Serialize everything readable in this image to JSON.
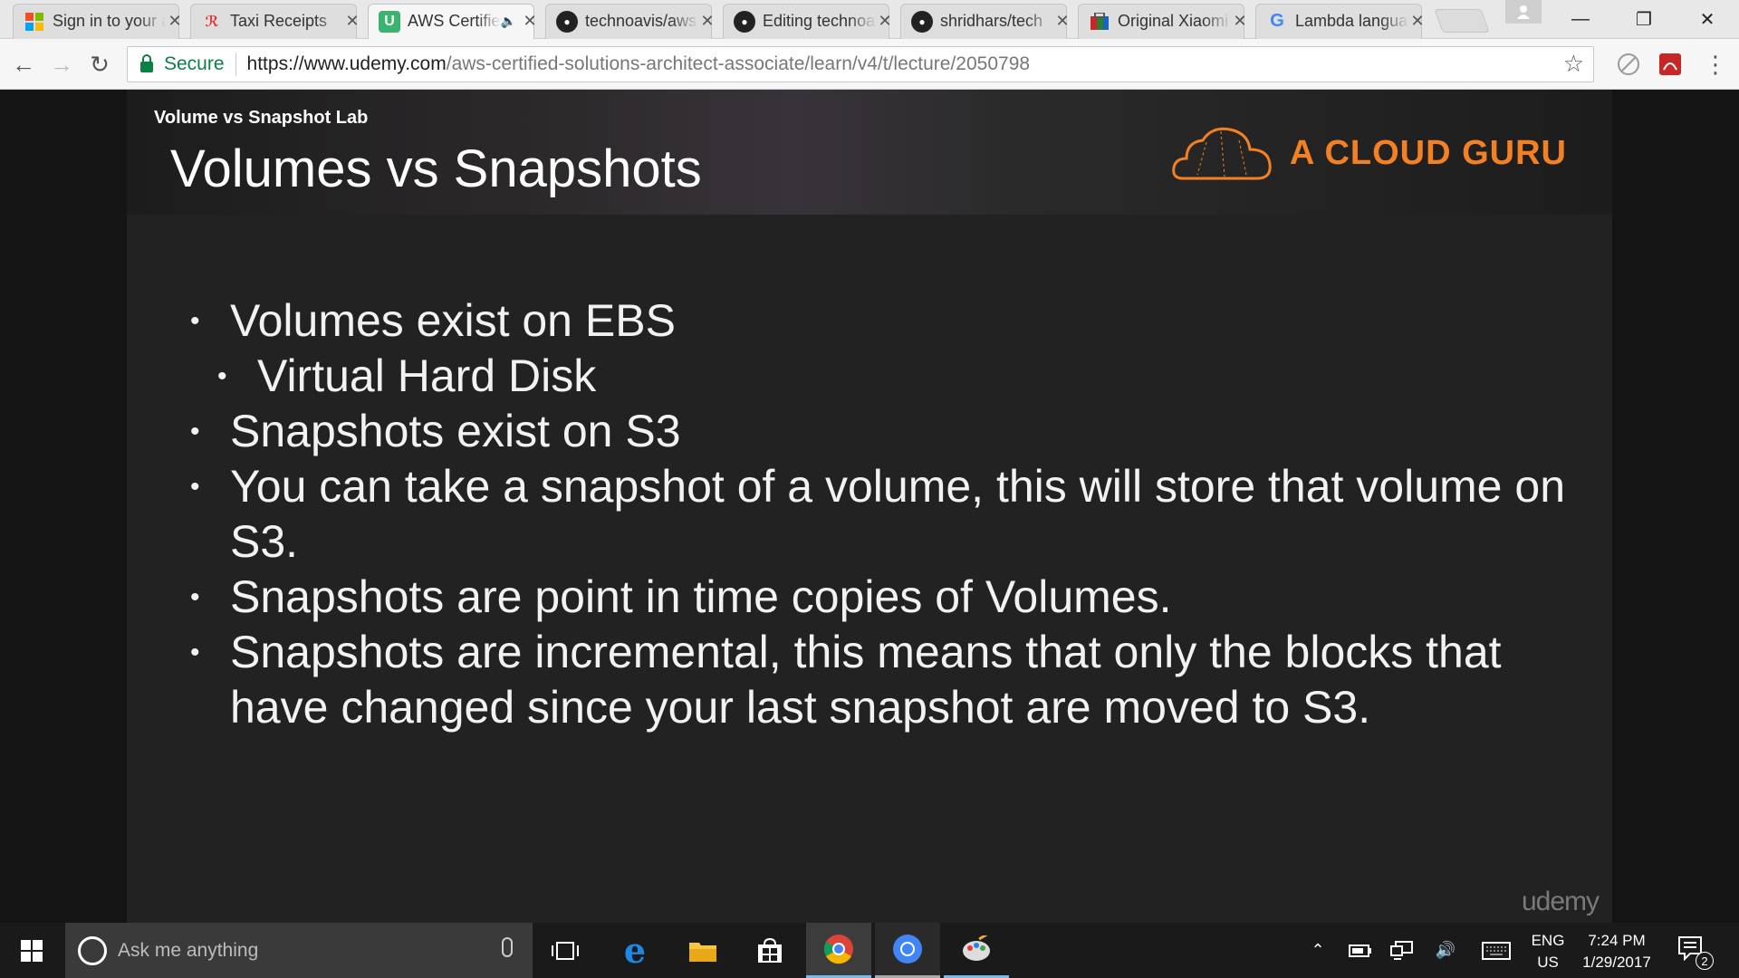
{
  "browser": {
    "tabs": [
      {
        "title": "Sign in to your account",
        "favicon": "microsoft-icon",
        "active": false
      },
      {
        "title": "Taxi Receipts",
        "favicon": "receipt-icon",
        "active": false
      },
      {
        "title": "AWS Certified Solutions Architect",
        "favicon": "udemy-icon",
        "active": true,
        "audio": true
      },
      {
        "title": "technoavis/aws",
        "favicon": "github-icon",
        "active": false
      },
      {
        "title": "Editing technoavis",
        "favicon": "github-icon",
        "active": false
      },
      {
        "title": "shridhars/tech",
        "favicon": "github-icon",
        "active": false
      },
      {
        "title": "Original Xiaomi",
        "favicon": "shop-icon",
        "active": false
      },
      {
        "title": "Lambda language",
        "favicon": "google-icon",
        "active": false
      }
    ],
    "address": {
      "secure_label": "Secure",
      "url_host": "https://www.udemy.com",
      "url_path": "/aws-certified-solutions-architect-associate/learn/v4/t/lecture/2050798"
    }
  },
  "slide": {
    "lab_label": "Volume vs Snapshot Lab",
    "title": "Volumes vs Snapshots",
    "brand": "A CLOUD GURU",
    "bullets": [
      {
        "text": "Volumes exist on EBS",
        "level": 1
      },
      {
        "text": "Virtual Hard Disk",
        "level": 2
      },
      {
        "text": "Snapshots exist on S3",
        "level": 1
      },
      {
        "text": "You can take a snapshot of a volume, this will store that volume on S3.",
        "level": 1
      },
      {
        "text": "Snapshots are point in time copies of Volumes.",
        "level": 1
      },
      {
        "text": "Snapshots are incremental, this means that only the blocks that have changed since your last snapshot are moved to S3.",
        "level": 1
      }
    ],
    "watermark": "udemy",
    "brand_color": "#f48024"
  },
  "taskbar": {
    "search_placeholder": "Ask me anything",
    "lang_line1": "ENG",
    "lang_line2": "US",
    "time": "7:24 PM",
    "date": "1/29/2017",
    "notification_count": "2"
  }
}
